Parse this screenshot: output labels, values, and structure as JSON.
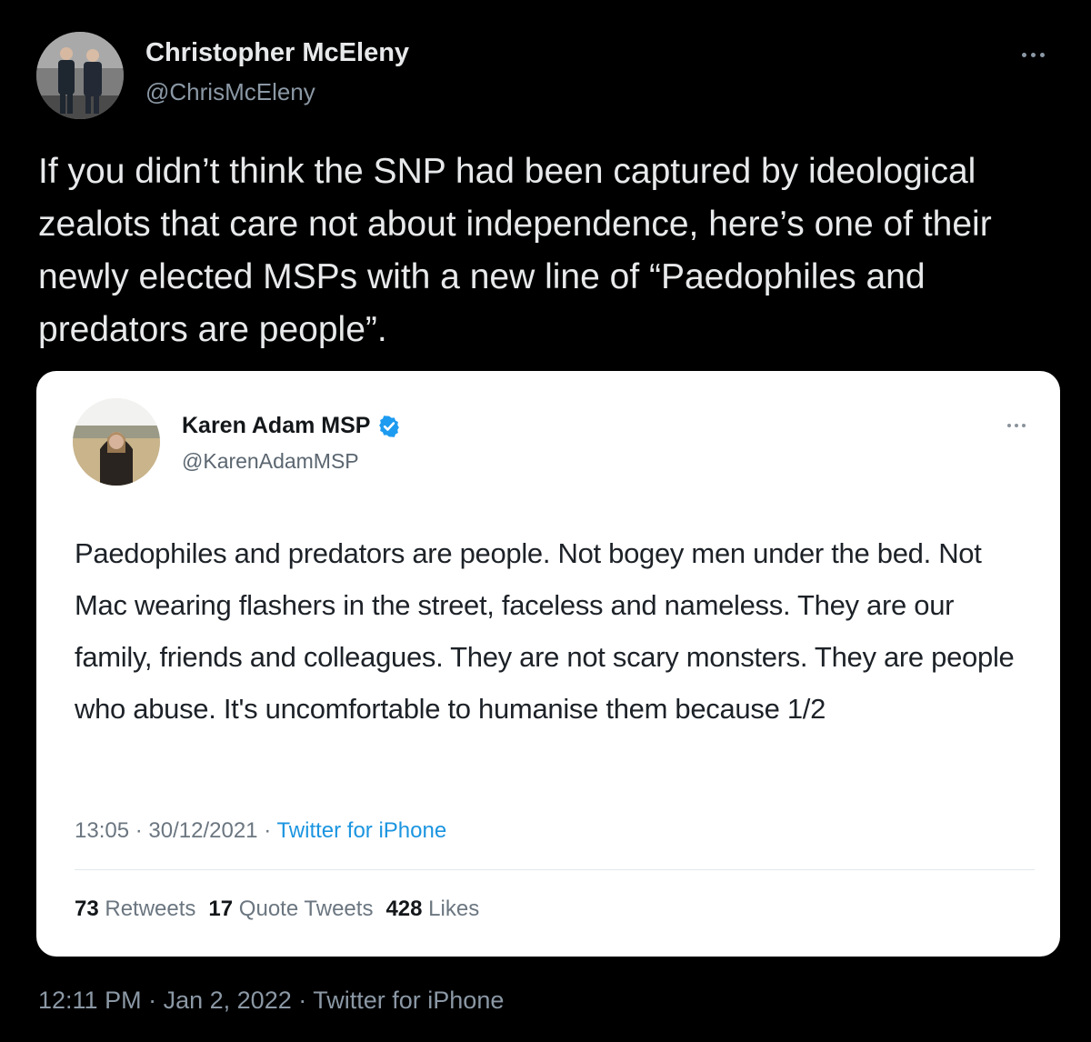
{
  "author": {
    "name": "Christopher McEleny",
    "handle": "@ChrisMcEleny"
  },
  "tweet": {
    "text": "If you didn’t think the SNP had been captured by ideological zealots that care not about independence, here’s one of their newly elected MSPs with a new line of “Paedophiles and predators are people”.",
    "time": "12:11 PM",
    "date": "Jan 2, 2022",
    "source": "Twitter for iPhone",
    "separator": "·"
  },
  "quoted": {
    "name": "Karen Adam MSP",
    "handle": "@KarenAdamMSP",
    "text": "Paedophiles and predators are people. Not bogey men under the bed. Not Mac wearing flashers in the street, faceless and nameless. They are our family, friends and colleagues. They are not scary monsters. They are people who abuse. It's uncomfortable to humanise them because 1/2",
    "time": "13:05",
    "date": "30/12/2021",
    "source": "Twitter for iPhone",
    "separator": "·",
    "stats": {
      "retweets_count": "73",
      "retweets_label": "Retweets",
      "quotes_count": "17",
      "quotes_label": "Quote Tweets",
      "likes_count": "428",
      "likes_label": "Likes"
    }
  },
  "colors": {
    "background": "#000000",
    "primary_text": "#e7e9ea",
    "secondary_text": "#8b98a5",
    "card_background": "#ffffff",
    "verified_blue": "#1d9bf0",
    "link_blue": "#1b95e0"
  },
  "icons": {
    "more": "more-horizontal-icon",
    "verified": "verified-badge-icon"
  }
}
